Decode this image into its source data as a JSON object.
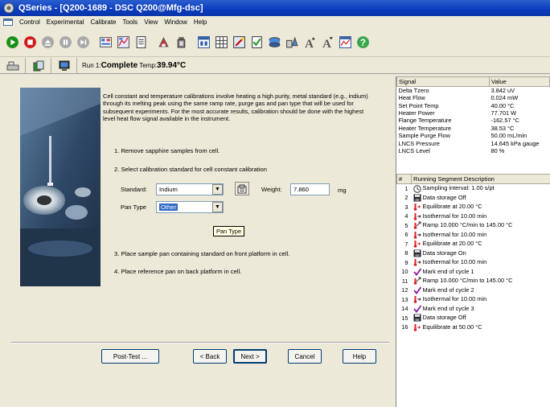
{
  "window": {
    "title": "QSeries - [Q200-1689 - DSC Q200@Mfg-dsc]"
  },
  "menu": [
    "Control",
    "Experimental",
    "Calibrate",
    "Tools",
    "View",
    "Window",
    "Help"
  ],
  "toolbar": [
    "start",
    "stop",
    "eject",
    "pause",
    "next-segment",
    "summary",
    "procedure",
    "notes",
    "calibrate",
    "tools",
    "view1",
    "view2",
    "checklist",
    "autosampler",
    "signals",
    "font-up",
    "font-down",
    "graph",
    "help"
  ],
  "run": {
    "prefix": "Run 1:",
    "status": "Complete",
    "temp_label": "Temp:",
    "temp": "39.94°C"
  },
  "wizard": {
    "intro": "Cell constant and temperature calibrations involve heating a high purity, metal standard (e.g., indium) through its melting peak using the same ramp rate, purge gas and pan type that will be used for subsequent experiments.  For the most accurate results, calibration should be done with the highest level heat flow signal available in the instrument.",
    "step1": "1. Remove sapphire samples from cell.",
    "step2": "2. Select calibration standard for cell constant calibration",
    "standard_label": "Standard:",
    "standard_value": "Indium",
    "weight_label": "Weight:",
    "weight_value": "7.860",
    "weight_unit": "mg",
    "pantype_label": "Pan Type",
    "pantype_value": "Other",
    "tooltip": "Pan Type",
    "step3": "3. Place sample pan containing standard on front platform in cell.",
    "step4": "4. Place reference pan on back platform in cell.",
    "buttons": {
      "posttest": "Post-Test ...",
      "back": "< Back",
      "next": "Next >",
      "cancel": "Cancel",
      "help": "Help"
    }
  },
  "signals": {
    "headers": [
      "Signal",
      "Value"
    ],
    "rows": [
      [
        "Delta Tzero",
        "3.842 uV"
      ],
      [
        "Heat Flow",
        "0.024 mW"
      ],
      [
        "Set Point Temp",
        "40.00 °C"
      ],
      [
        "Heater Power",
        "77.701 W"
      ],
      [
        "Flange Temperature",
        "-162.57 °C"
      ],
      [
        "Heater Temperature",
        "38.53 °C"
      ],
      [
        "Sample Purge Flow",
        "50.00 mL/min"
      ],
      [
        "LNCS Pressure",
        "14.645 kPa gauge"
      ],
      [
        "LNCS Level",
        "80 %"
      ]
    ]
  },
  "segments": {
    "headers": [
      "#",
      "Running Segment Description"
    ],
    "rows": [
      {
        "n": "1",
        "icon": "clock-icon",
        "text": "Sampling interval: 1.00 s/pt"
      },
      {
        "n": "2",
        "icon": "disk-icon",
        "text": "Data storage Off"
      },
      {
        "n": "3",
        "icon": "thermo-icon",
        "text": "Equilibrate at 20.00 °C"
      },
      {
        "n": "4",
        "icon": "iso-icon",
        "text": "Isothermal for 10.00 min"
      },
      {
        "n": "5",
        "icon": "ramp-icon",
        "text": "Ramp 10.000 °C/min to 145.00 °C"
      },
      {
        "n": "6",
        "icon": "iso-icon",
        "text": "Isothermal for 10.00 min"
      },
      {
        "n": "7",
        "icon": "thermo-icon",
        "text": "Equilibrate at 20.00 °C"
      },
      {
        "n": "8",
        "icon": "disk-icon",
        "text": "Data storage On"
      },
      {
        "n": "9",
        "icon": "iso-icon",
        "text": "Isothermal for 10.00 min"
      },
      {
        "n": "10",
        "icon": "check-icon",
        "text": "Mark end of cycle 1"
      },
      {
        "n": "11",
        "icon": "ramp-icon",
        "text": "Ramp 10.000 °C/min to 145.00 °C"
      },
      {
        "n": "12",
        "icon": "check-icon",
        "text": "Mark end of cycle 2"
      },
      {
        "n": "13",
        "icon": "iso-icon",
        "text": "Isothermal for 10.00 min"
      },
      {
        "n": "14",
        "icon": "check-icon",
        "text": "Mark end of cycle 3"
      },
      {
        "n": "15",
        "icon": "disk-icon",
        "text": "Data storage Off"
      },
      {
        "n": "16",
        "icon": "thermo-icon",
        "text": "Equilibrate at 50.00 °C"
      }
    ]
  }
}
